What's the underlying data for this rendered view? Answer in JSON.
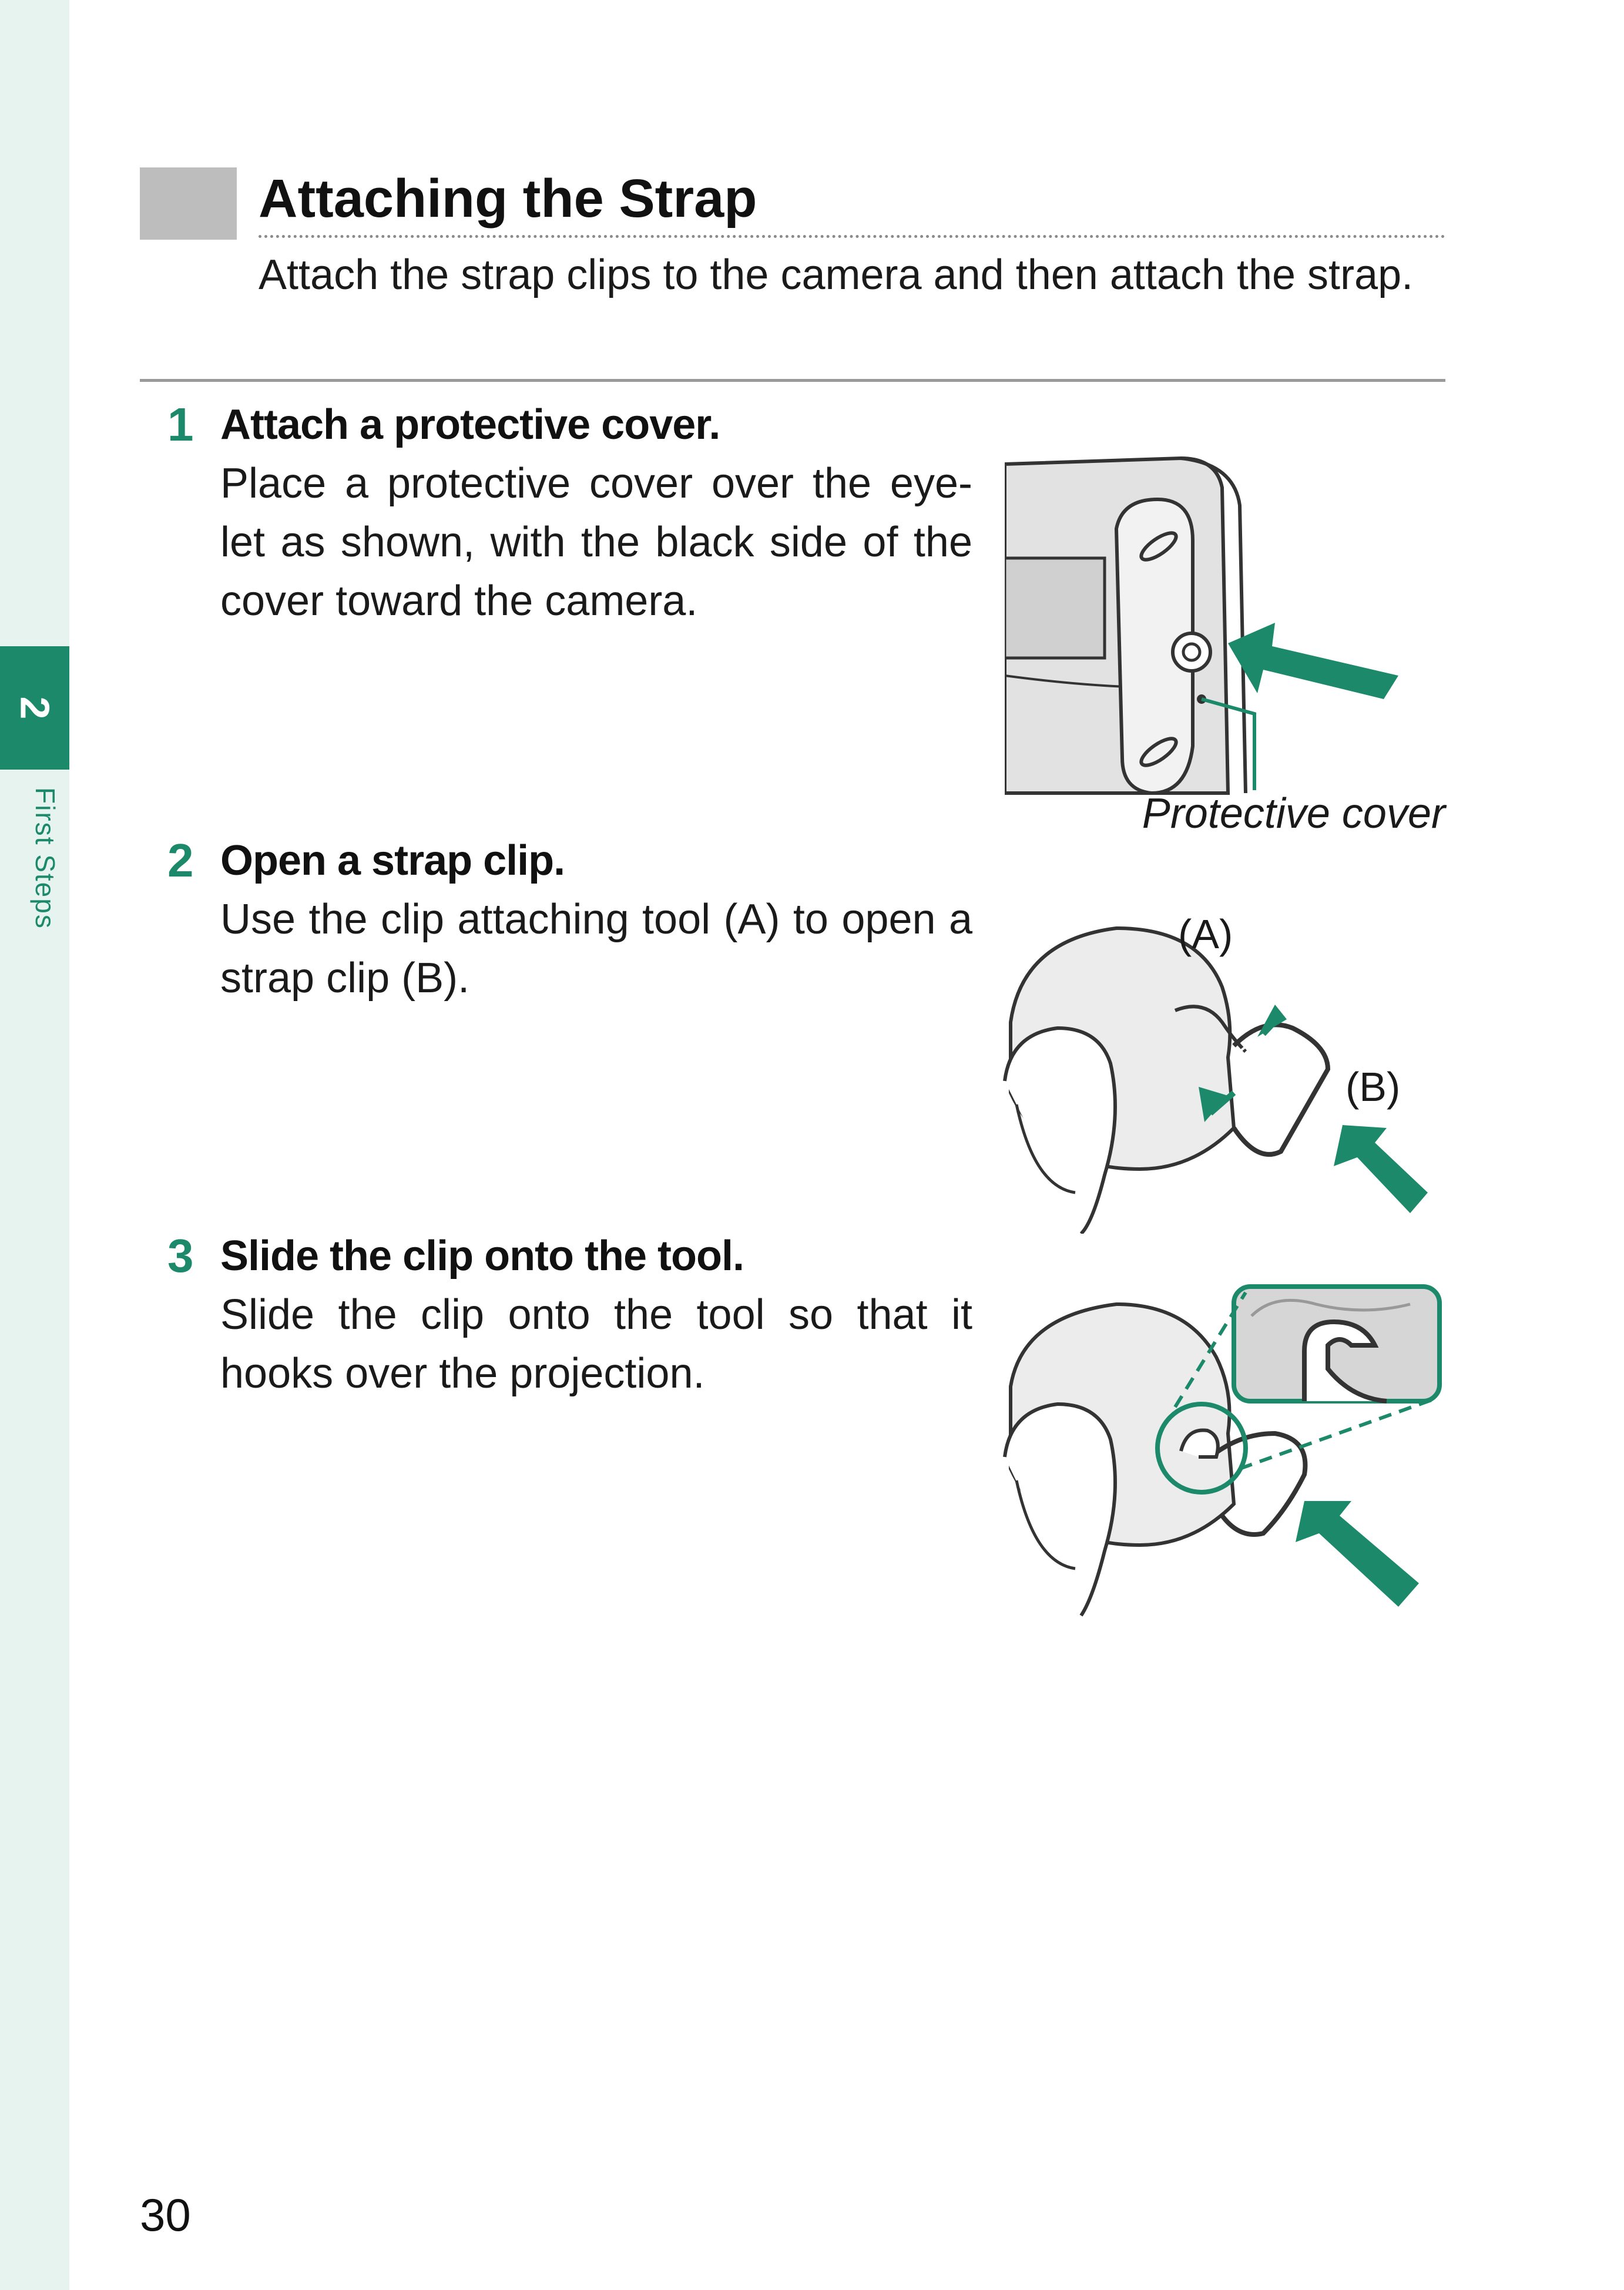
{
  "sidebar": {
    "chapter_number": "2",
    "chapter_label": "First Steps"
  },
  "section": {
    "title": "Attaching the Strap",
    "intro": "Attach the strap clips to the camera and then attach the strap."
  },
  "steps": [
    {
      "number": "1",
      "heading": "Attach a protective cover.",
      "body": "Place a protective cover over the eye-let as shown, with the black side of the cover toward the camera.",
      "caption": "Protective cover"
    },
    {
      "number": "2",
      "heading": "Open a strap clip.",
      "body": "Use the clip attaching tool (A) to open a strap clip (B).",
      "callouts": [
        "(A)",
        "(B)"
      ]
    },
    {
      "number": "3",
      "heading": "Slide the clip onto the tool.",
      "body": "Slide the clip onto the tool so that it hooks over the projection."
    }
  ],
  "colors": {
    "accent": "#1c8a6a",
    "sidebar_bg": "#e7f3ee",
    "header_box": "#bdbdbd"
  },
  "page": {
    "number": "30"
  }
}
